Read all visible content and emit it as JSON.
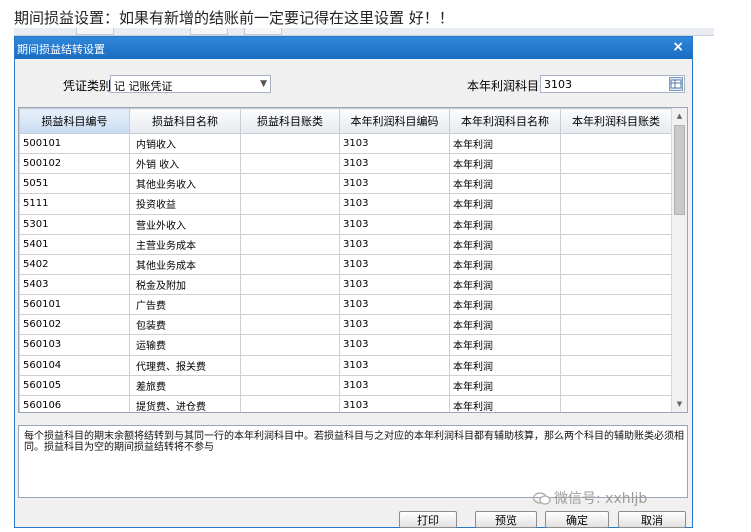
{
  "caption": "期间损益设置：如果有新增的结账前一定要记得在这里设置 好！！",
  "dialog": {
    "title": "期间损益结转设置",
    "close_label": "×",
    "voucher_type_label": "凭证类别",
    "voucher_type_value": "记  记账凭证",
    "profit_account_label": "本年利润科目",
    "profit_account_value": "3103"
  },
  "grid": {
    "columns": [
      "损益科目编号",
      "损益科目名称",
      "损益科目账类",
      "本年利润科目编码",
      "本年利润科目名称",
      "本年利润科目账类"
    ],
    "rows": [
      [
        "500101",
        "内销收入",
        "",
        "3103",
        "本年利润",
        ""
      ],
      [
        "500102",
        "外销 收入",
        "",
        "3103",
        "本年利润",
        ""
      ],
      [
        "5051",
        "其他业务收入",
        "",
        "3103",
        "本年利润",
        ""
      ],
      [
        "5111",
        "投资收益",
        "",
        "3103",
        "本年利润",
        ""
      ],
      [
        "5301",
        "营业外收入",
        "",
        "3103",
        "本年利润",
        ""
      ],
      [
        "5401",
        "主营业务成本",
        "",
        "3103",
        "本年利润",
        ""
      ],
      [
        "5402",
        "其他业务成本",
        "",
        "3103",
        "本年利润",
        ""
      ],
      [
        "5403",
        "税金及附加",
        "",
        "3103",
        "本年利润",
        ""
      ],
      [
        "560101",
        "广告费",
        "",
        "3103",
        "本年利润",
        ""
      ],
      [
        "560102",
        "包装费",
        "",
        "3103",
        "本年利润",
        ""
      ],
      [
        "560103",
        "运输费",
        "",
        "3103",
        "本年利润",
        ""
      ],
      [
        "560104",
        "代理费、报关费",
        "",
        "3103",
        "本年利润",
        ""
      ],
      [
        "560105",
        "差旅费",
        "",
        "3103",
        "本年利润",
        ""
      ],
      [
        "560106",
        "提货费、进仓费",
        "",
        "3103",
        "本年利润",
        ""
      ]
    ]
  },
  "note": "每个损益科目的期末余额将结转到与其同一行的本年利润科目中。若损益科目与之对应的本年利润科目都有辅助核算，那么两个科目的辅助账类必须相同。损益科目为空的期间损益结转将不参与",
  "watermark": "微信号: xxhljb",
  "buttons": {
    "print": "打印",
    "preview": "预览",
    "ok": "确定",
    "cancel": "取消"
  }
}
